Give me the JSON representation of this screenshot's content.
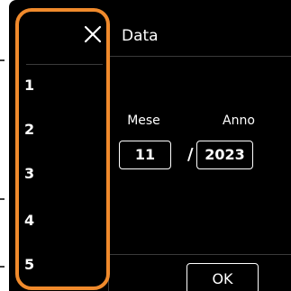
{
  "dialog": {
    "title": "Data",
    "month_label": "Mese",
    "year_label": "Anno",
    "month_value": "11",
    "separator": "/",
    "year_value": "2023",
    "ok_label": "OK"
  },
  "picker": {
    "close_icon": "close-icon",
    "items": [
      "1",
      "2",
      "3",
      "4",
      "5"
    ]
  },
  "colors": {
    "background": "#000000",
    "text": "#ffffff",
    "highlight_border": "#f08a2c",
    "divider": "#3a3a3a"
  }
}
